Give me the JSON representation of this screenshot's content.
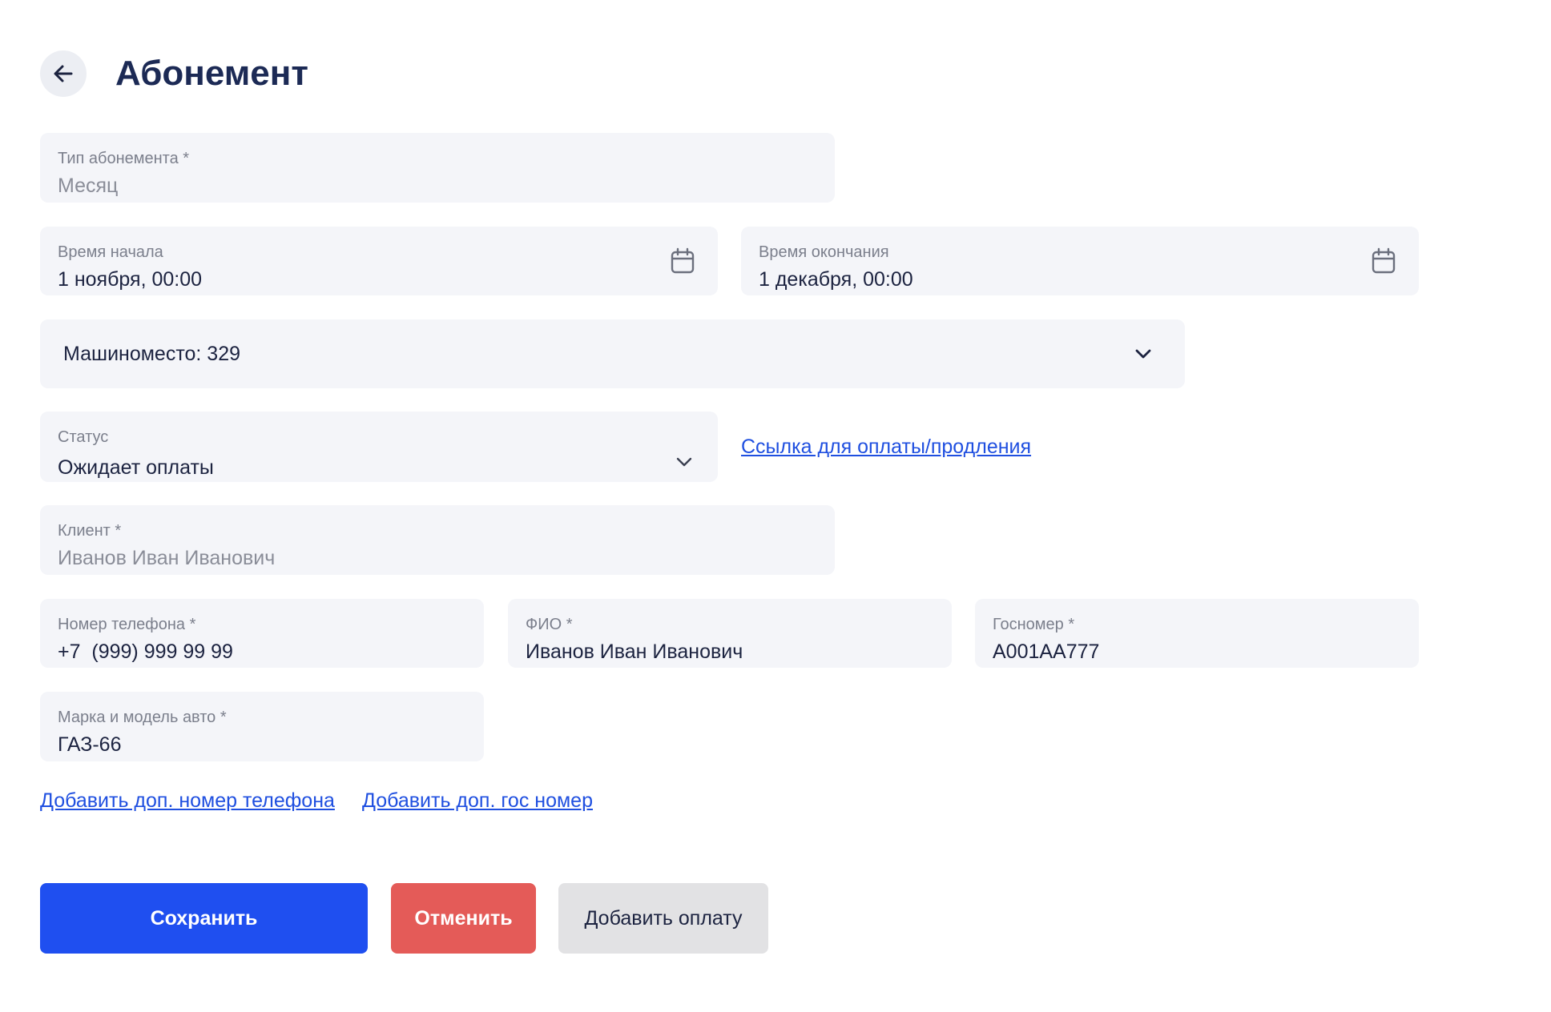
{
  "header": {
    "title": "Абонемент"
  },
  "subscription_type": {
    "label": "Тип абонемента *",
    "value": "Месяц"
  },
  "start_time": {
    "label": "Время начала",
    "value": "1 ноября, 00:00"
  },
  "end_time": {
    "label": "Время окончания",
    "value": "1 декабря, 00:00"
  },
  "parking_spot": {
    "value": "Машиноместо: 329"
  },
  "status": {
    "label": "Статус",
    "value": "Ожидает оплаты"
  },
  "payment_link": {
    "label": "Ссылка для оплаты/продления"
  },
  "client": {
    "label": "Клиент *",
    "value": "Иванов Иван Иванович"
  },
  "phone": {
    "label": "Номер телефона *",
    "value": "+7  (999) 999 99 99"
  },
  "full_name": {
    "label": "ФИО *",
    "value": "Иванов Иван Иванович"
  },
  "plate": {
    "label": "Госномер *",
    "value": "А001АА777"
  },
  "car_model": {
    "label": "Марка и модель авто *",
    "value": "ГАЗ-66"
  },
  "links": {
    "add_phone": "Добавить доп. номер телефона",
    "add_plate": "Добавить доп. гос номер"
  },
  "actions": {
    "save": "Сохранить",
    "cancel": "Отменить",
    "add_payment": "Добавить оплату"
  },
  "icons": {
    "back": "arrow-left-icon",
    "calendar": "calendar-icon",
    "dropdown": "chevron-down-icon"
  },
  "colors": {
    "primary": "#1f4ff0",
    "danger": "#e45b58",
    "secondary": "#e2e2e4",
    "field_bg": "#f4f5f9",
    "link": "#1f4fe0"
  }
}
